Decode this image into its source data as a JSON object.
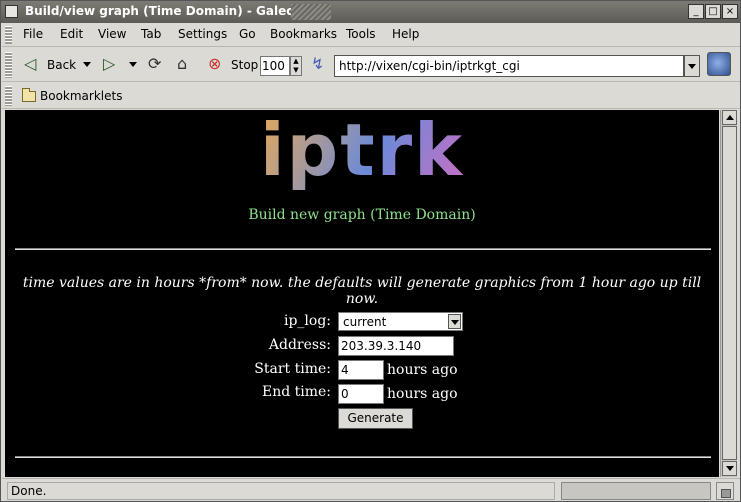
{
  "window": {
    "title": "Build/view graph (Time Domain) - Galeon"
  },
  "menu": [
    "File",
    "Edit",
    "View",
    "Tab",
    "Settings",
    "Go",
    "Bookmarks",
    "Tools",
    "Help"
  ],
  "toolbar": {
    "back_label": "Back",
    "stop_label": "Stop",
    "zoom_value": "100",
    "url": "http://vixen/cgi-bin/iptrkgt_cgi"
  },
  "bookmarks": {
    "folder_label": "Bookmarklets"
  },
  "page": {
    "logo": "iptrk",
    "subtitle": "Build new graph (Time Domain)",
    "note": "time values are in hours *from* now. the defaults will generate graphics from 1 hour ago up till now.",
    "form": {
      "iplog_label": "ip_log:",
      "iplog_value": "current",
      "address_label": "Address:",
      "address_value": "203.39.3.140",
      "start_label": "Start time:",
      "start_value": "4",
      "end_label": "End time:",
      "end_value": "0",
      "unit": "hours ago",
      "button": "Generate"
    }
  },
  "status": {
    "text": "Done."
  }
}
